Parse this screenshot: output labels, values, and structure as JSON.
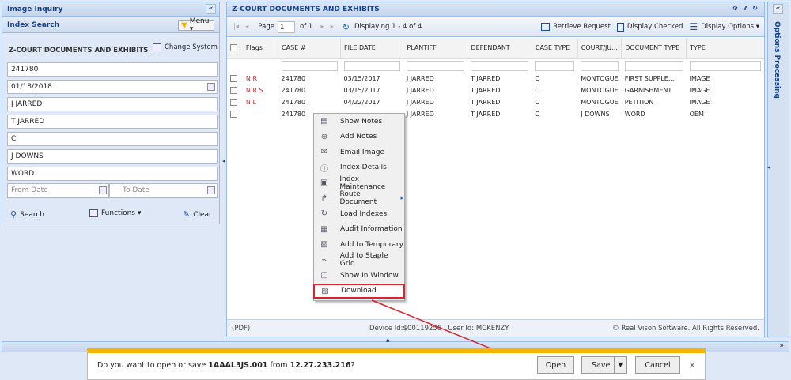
{
  "left": {
    "header_title": "Image Inquiry",
    "collapse_glyph": "«",
    "subheader": "Index Search",
    "menu_label": "Menu ▾",
    "system_title": "Z-COURT DOCUMENTS AND EXHIBITS",
    "change_system": "Change System",
    "fields": [
      "241780",
      "01/18/2018",
      "J JARRED",
      "T JARRED",
      "C",
      "J DOWNS",
      "WORD"
    ],
    "from_date_placeholder": "From Date",
    "to_date_placeholder": "To Date",
    "search_label": "Search",
    "functions_label": "Functions ▾",
    "clear_label": "Clear"
  },
  "main": {
    "header_title": "Z-COURT DOCUMENTS AND EXHIBITS",
    "header_icons": "⚙ ? ↻",
    "toolbar": {
      "page_label": "Page",
      "page_value": "1",
      "of_label": "of 1",
      "displaying": "Displaying 1 - 4 of 4",
      "retrieve": "Retrieve Request",
      "display_checked": "Display Checked",
      "display_options": "Display Options ▾"
    },
    "columns": [
      "Flags",
      "CASE #",
      "FILE DATE",
      "PLANTIFF",
      "DEFENDANT",
      "CASE TYPE",
      "COURT/JU...",
      "DOCUMENT TYPE",
      "TYPE"
    ],
    "rows": [
      {
        "flags": "N R",
        "case": "241780",
        "date": "03/15/2017",
        "plaintiff": "J JARRED",
        "defendant": "T JARRED",
        "ctype": "C",
        "court": "MONTOGUE",
        "doctype": "FIRST SUPPLE...",
        "type": "IMAGE"
      },
      {
        "flags": "N R S",
        "case": "241780",
        "date": "03/15/2017",
        "plaintiff": "J JARRED",
        "defendant": "T JARRED",
        "ctype": "C",
        "court": "MONTOGUE",
        "doctype": "GARNISHMENT",
        "type": "IMAGE"
      },
      {
        "flags": "N L",
        "case": "241780",
        "date": "04/22/2017",
        "plaintiff": "J JARRED",
        "defendant": "T JARRED",
        "ctype": "C",
        "court": "MONTOGUE",
        "doctype": "PETITION",
        "type": "IMAGE"
      },
      {
        "flags": "",
        "case": "241780",
        "date": "",
        "plaintiff": "J JARRED",
        "defendant": "T JARRED",
        "ctype": "C",
        "court": "J DOWNS",
        "doctype": "WORD",
        "type": "OEM"
      }
    ],
    "status_left": "(PDF)",
    "status_mid": "Device Id:$00119256   User Id: MCKENZY",
    "status_right": "© Real Vison Software. All Rights Reserved."
  },
  "context_menu": [
    {
      "icon": "notes-icon",
      "glyph": "▤",
      "label": "Show Notes"
    },
    {
      "icon": "add-icon",
      "glyph": "⊕",
      "label": "Add Notes"
    },
    {
      "icon": "email-icon",
      "glyph": "✉",
      "label": "Email Image"
    },
    {
      "icon": "info-icon",
      "glyph": "ⓘ",
      "label": "Index Details"
    },
    {
      "icon": "maintenance-icon",
      "glyph": "▣",
      "label": "Index Maintenance"
    },
    {
      "icon": "route-icon",
      "glyph": "↱",
      "label": "Route Document"
    },
    {
      "icon": "refresh-icon",
      "glyph": "↻",
      "label": "Load Indexes"
    },
    {
      "icon": "audit-icon",
      "glyph": "▦",
      "label": "Audit Information"
    },
    {
      "icon": "save-icon",
      "glyph": "▨",
      "label": "Add to Temporary"
    },
    {
      "icon": "staple-icon",
      "glyph": "⌁",
      "label": "Add to Staple Grid"
    },
    {
      "icon": "window-icon",
      "glyph": "▢",
      "label": "Show In Window"
    },
    {
      "icon": "download-icon",
      "glyph": "▨",
      "label": "Download"
    }
  ],
  "options_label": "Options Processing",
  "download_bar": {
    "prefix": "Do you want to open or save ",
    "filename": "1AAAL3JS.001",
    "middle": " from ",
    "host": "12.27.233.216",
    "suffix": "?",
    "open": "Open",
    "save": "Save",
    "cancel": "Cancel",
    "close": "×"
  },
  "colors": {
    "accent": "#15428b",
    "highlight": "#d9262e",
    "header_bg": "#c5d6ee",
    "download_bar": "#f8b500"
  }
}
